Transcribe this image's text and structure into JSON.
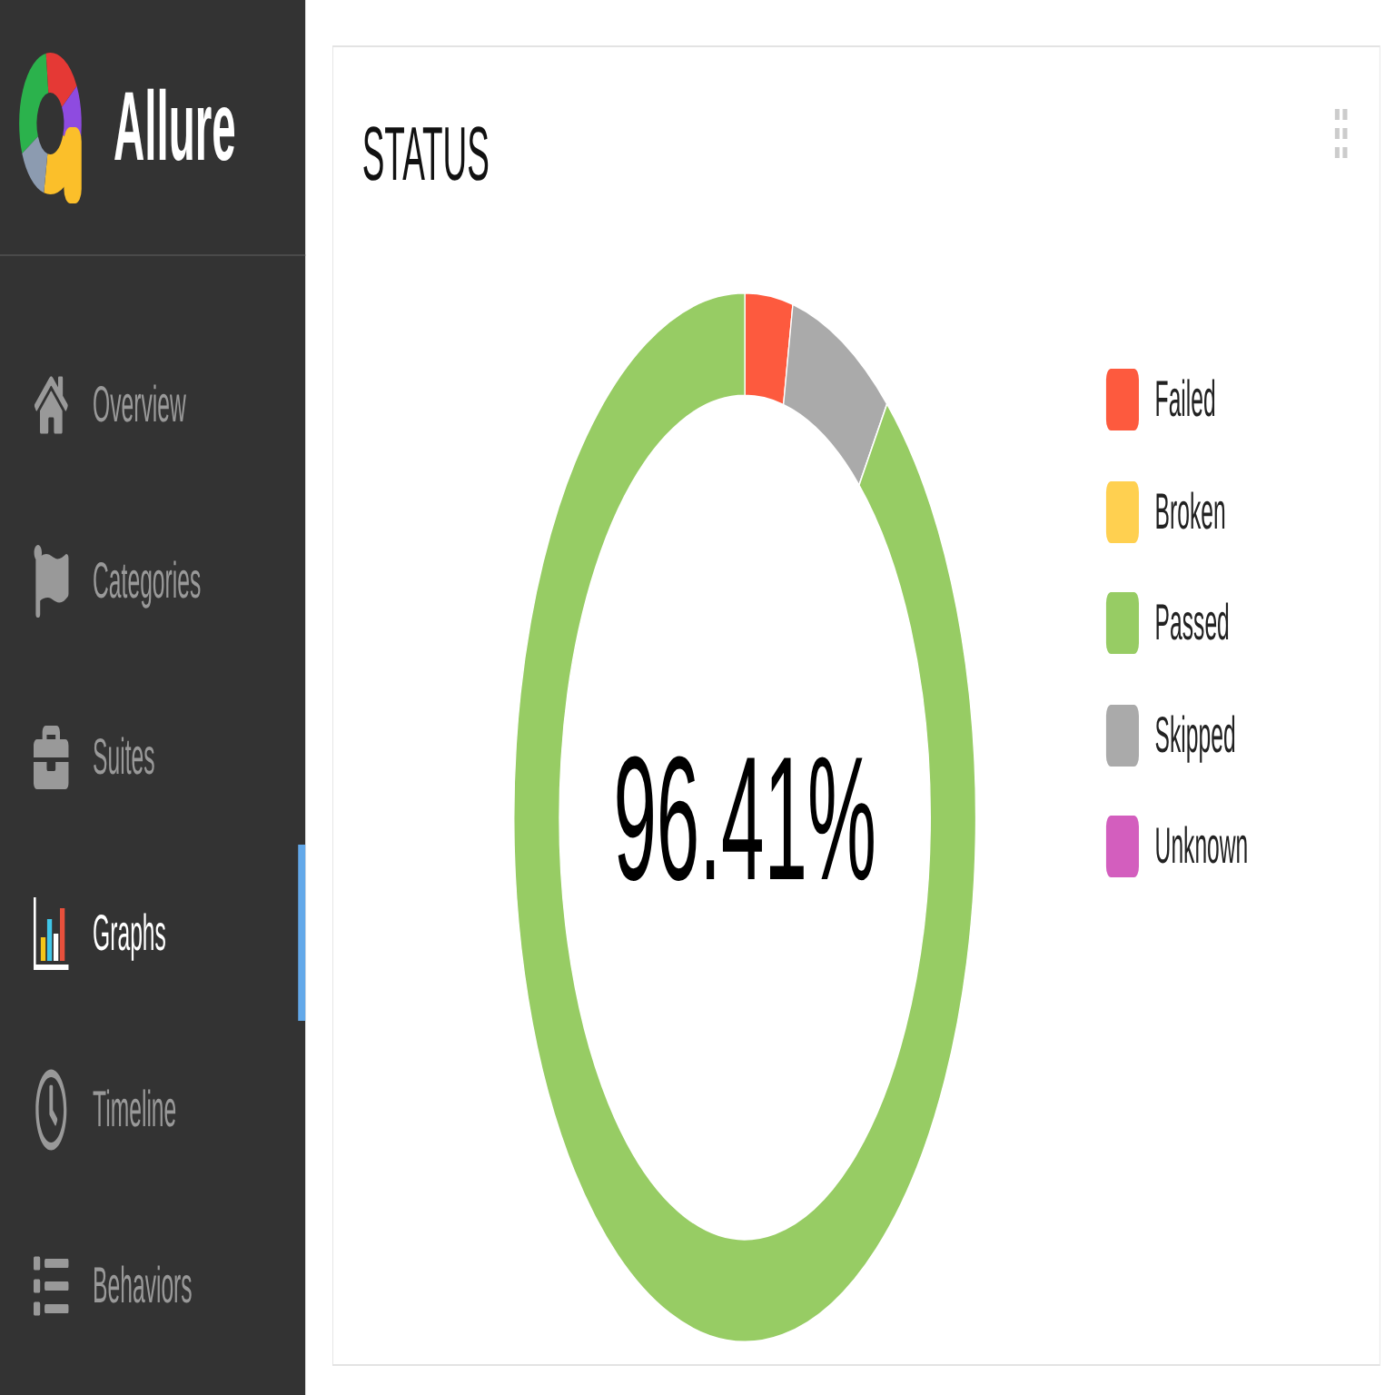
{
  "sidebar": {
    "brand": "Allure",
    "items": [
      {
        "label": "Overview",
        "selected": false
      },
      {
        "label": "Categories",
        "selected": false
      },
      {
        "label": "Suites",
        "selected": false
      },
      {
        "label": "Graphs",
        "selected": true
      },
      {
        "label": "Timeline",
        "selected": false
      },
      {
        "label": "Behaviors",
        "selected": false
      }
    ]
  },
  "status_card": {
    "title": "STATUS",
    "center_label": "96.41%",
    "legend": [
      {
        "label": "Failed",
        "color": "#fd5a3e"
      },
      {
        "label": "Broken",
        "color": "#ffd050"
      },
      {
        "label": "Passed",
        "color": "#97cc64"
      },
      {
        "label": "Skipped",
        "color": "#aaaaaa"
      },
      {
        "label": "Unknown",
        "color": "#d35ebe"
      }
    ]
  }
}
